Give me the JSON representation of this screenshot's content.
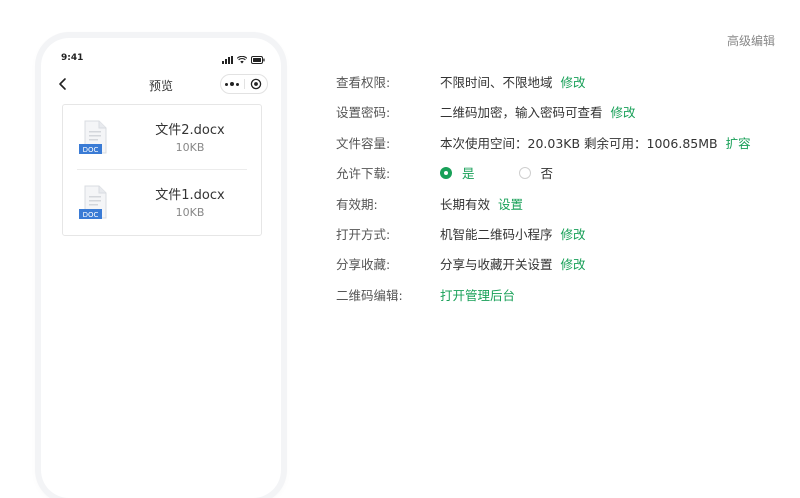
{
  "phone": {
    "time": "9:41",
    "nav_title": "预览",
    "files": [
      {
        "name": "文件2.docx",
        "size": "10KB",
        "badge": "DOC"
      },
      {
        "name": "文件1.docx",
        "size": "10KB",
        "badge": "DOC"
      }
    ]
  },
  "header": {
    "advanced_edit": "高级编辑"
  },
  "settings": {
    "view_permission": {
      "label": "查看权限:",
      "value": "不限时间、不限地域",
      "action": "修改"
    },
    "set_password": {
      "label": "设置密码:",
      "value": "二维码加密，输入密码可查看",
      "action": "修改"
    },
    "file_capacity": {
      "label": "文件容量:",
      "value": "本次使用空间：20.03KB 剩余可用：1006.85MB",
      "action": "扩容"
    },
    "allow_download": {
      "label": "允许下载:",
      "option_yes": "是",
      "option_no": "否",
      "selected": "是"
    },
    "validity": {
      "label": "有效期:",
      "value": "长期有效",
      "action": "设置"
    },
    "open_mode": {
      "label": "打开方式:",
      "value": "机智能二维码小程序",
      "action": "修改"
    },
    "share_favorite": {
      "label": "分享收藏:",
      "value": "分享与收藏开关设置",
      "action": "修改"
    },
    "qr_edit": {
      "label": "二维码编辑:",
      "action": "打开管理后台"
    }
  },
  "colors": {
    "accent": "#18a058",
    "doc_badge": "#3a7bd5"
  },
  "icons": [
    "back-icon",
    "more-dots-icon",
    "target-close-icon",
    "signal-icon",
    "wifi-icon",
    "battery-icon",
    "doc-file-icon"
  ]
}
